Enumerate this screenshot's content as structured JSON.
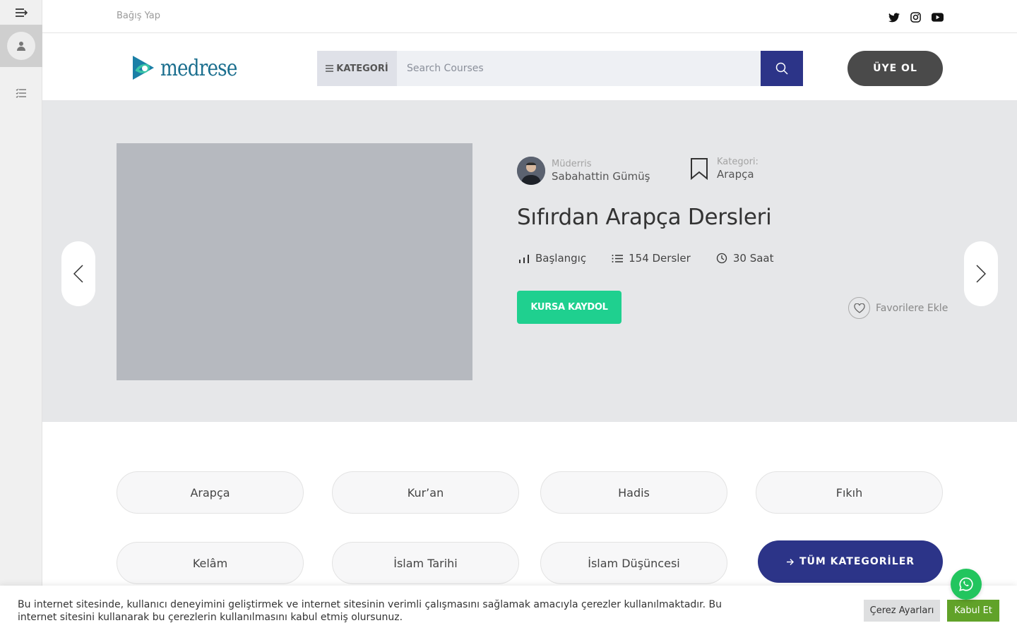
{
  "topbar": {
    "donate_label": "Bağış Yap",
    "social": [
      "twitter-icon",
      "instagram-icon",
      "youtube-icon"
    ]
  },
  "header": {
    "logo_text": "medrese",
    "category_label": "KATEGORİ",
    "search_placeholder": "Search Courses",
    "signup_label": "ÜYE OL"
  },
  "hero": {
    "instructor_label": "Müderris",
    "instructor_name": "Sabahattin Gümüş",
    "category_label": "Kategori:",
    "category_value": "Arapça",
    "title": "Sıfırdan Arapça Dersleri",
    "level": "Başlangıç",
    "lessons": "154 Dersler",
    "duration": "30 Saat",
    "enroll_label": "KURSA KAYDOL",
    "favorite_label": "Favorilere Ekle"
  },
  "categories": {
    "items": [
      "Arapça",
      "Kur’an",
      "Hadis",
      "Fıkıh",
      "Kelâm",
      "İslam Tarihi",
      "İslam Düşüncesi"
    ],
    "all_label": "TÜM KATEGORİLER"
  },
  "cookie": {
    "text": "Bu internet sitesinde, kullanıcı deneyimini geliştirmek ve internet sitesinin verimli çalışmasını sağlamak amacıyla çerezler kullanılmaktadır. Bu internet sitesini kullanarak bu çerezlerin kullanılmasını kabul etmiş olursunuz.",
    "settings_label": "Çerez Ayarları",
    "accept_label": "Kabul Et"
  },
  "colors": {
    "primary": "#2c3488",
    "enroll": "#1fd08f",
    "accept": "#61a229",
    "whatsapp": "#22c55e",
    "signup": "#4a4a4a"
  }
}
